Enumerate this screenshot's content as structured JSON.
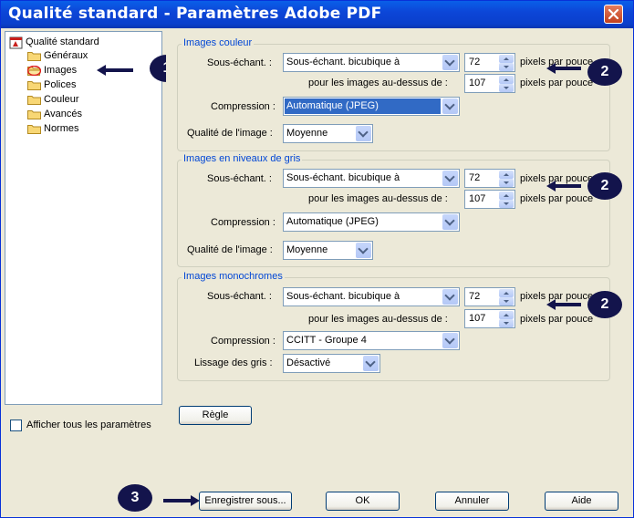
{
  "window": {
    "title": "Qualité standard - Paramètres Adobe PDF"
  },
  "tree": {
    "root": "Qualité standard",
    "items": [
      "Généraux",
      "Images",
      "Polices",
      "Couleur",
      "Avancés",
      "Normes"
    ],
    "selected": "Images"
  },
  "color_group": {
    "title": "Images couleur",
    "downsample_label": "Sous-échant. :",
    "downsample_value": "Sous-échant. bicubique à",
    "res_value": "72",
    "res_unit": "pixels par pouce",
    "above_label": "pour les images au-dessus de :",
    "above_value": "107",
    "above_unit": "pixels par pouce",
    "compression_label": "Compression :",
    "compression_value": "Automatique (JPEG)",
    "quality_label": "Qualité de l'image :",
    "quality_value": "Moyenne"
  },
  "gray_group": {
    "title": "Images en niveaux de gris",
    "downsample_label": "Sous-échant. :",
    "downsample_value": "Sous-échant. bicubique à",
    "res_value": "72",
    "res_unit": "pixels par pouce",
    "above_label": "pour les images au-dessus de :",
    "above_value": "107",
    "above_unit": "pixels par pouce",
    "compression_label": "Compression :",
    "compression_value": "Automatique (JPEG)",
    "quality_label": "Qualité de l'image :",
    "quality_value": "Moyenne"
  },
  "mono_group": {
    "title": "Images monochromes",
    "downsample_label": "Sous-échant. :",
    "downsample_value": "Sous-échant. bicubique à",
    "res_value": "72",
    "res_unit": "pixels par pouce",
    "above_label": "pour les images au-dessus de :",
    "above_value": "107",
    "above_unit": "pixels par pouce",
    "compression_label": "Compression :",
    "compression_value": "CCITT - Groupe 4",
    "smoothing_label": "Lissage des gris :",
    "smoothing_value": "Désactivé"
  },
  "buttons": {
    "rule": "Règle",
    "save_as": "Enregistrer sous...",
    "ok": "OK",
    "cancel": "Annuler",
    "help": "Aide"
  },
  "show_all_label": "Afficher tous les paramètres",
  "callouts": [
    "1",
    "2",
    "2",
    "2",
    "3"
  ],
  "colors": {
    "title_bar": "#0a3fcb",
    "dialog_bg": "#ece9d8",
    "group_title": "#0046d5",
    "selection": "#316ac5",
    "callout": "#13144c"
  }
}
